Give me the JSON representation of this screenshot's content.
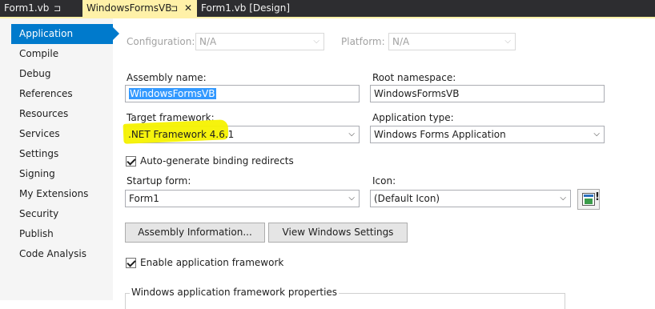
{
  "tabs": [
    {
      "label": "Form1.vb",
      "pin": "⊐"
    },
    {
      "label": "WindowsFormsVB",
      "pin": "⊐",
      "close": "✕"
    },
    {
      "label": "Form1.vb [Design]"
    }
  ],
  "sidebar": {
    "items": [
      {
        "label": "Application"
      },
      {
        "label": "Compile"
      },
      {
        "label": "Debug"
      },
      {
        "label": "References"
      },
      {
        "label": "Resources"
      },
      {
        "label": "Services"
      },
      {
        "label": "Settings"
      },
      {
        "label": "Signing"
      },
      {
        "label": "My Extensions"
      },
      {
        "label": "Security"
      },
      {
        "label": "Publish"
      },
      {
        "label": "Code Analysis"
      }
    ],
    "active_index": 0
  },
  "config": {
    "configuration_label": "Configuration:",
    "configuration_value": "N/A",
    "platform_label": "Platform:",
    "platform_value": "N/A"
  },
  "form": {
    "assembly_name_label": "Assembly name:",
    "assembly_name_value": "WindowsFormsVB",
    "root_namespace_label": "Root namespace:",
    "root_namespace_value": "WindowsFormsVB",
    "target_framework_label": "Target framework:",
    "target_framework_value": ".NET Framework 4.6.1",
    "application_type_label": "Application type:",
    "application_type_value": "Windows Forms Application",
    "auto_binding_label": "Auto-generate binding redirects",
    "auto_binding_checked": true,
    "startup_form_label": "Startup form:",
    "startup_form_value": "Form1",
    "icon_label": "Icon:",
    "icon_value": "(Default Icon)",
    "assembly_info_button": "Assembly Information...",
    "view_windows_settings_button": "View Windows Settings",
    "enable_framework_label": "Enable application framework",
    "enable_framework_checked": true,
    "framework_group_title": "Windows application framework properties"
  },
  "icons": {
    "dropdown": "⌵",
    "pin": "pin-icon",
    "close": "close-icon",
    "app_icon_preview": "application-icon"
  },
  "colors": {
    "tab_strip_bg": "#2d2d30",
    "active_tab_bg": "#fff1a8",
    "sidebar_bg": "#f5f5f5",
    "active_nav_bg": "#007acc",
    "highlight": "#f5f200",
    "selection": "#3399ff"
  }
}
